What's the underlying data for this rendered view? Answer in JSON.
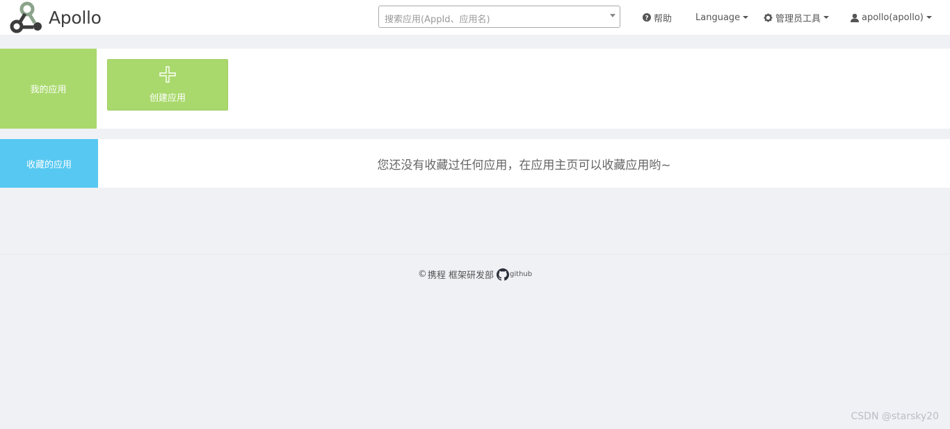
{
  "header": {
    "logo_text": "Apollo",
    "search": {
      "placeholder": "搜索应用(AppId、应用名)"
    },
    "nav": {
      "help": "帮助",
      "language": "Language",
      "admin_tools": "管理员工具",
      "user": "apollo(apollo)"
    }
  },
  "my_apps": {
    "section_label": "我的应用",
    "create_label": "创建应用"
  },
  "favorites": {
    "section_label": "收藏的应用",
    "empty_message": "您还没有收藏过任何应用，在应用主页可以收藏应用哟~"
  },
  "footer": {
    "copyright_symbol": "©",
    "company": "携程 框架研发部",
    "github_label": "github"
  },
  "watermark": "CSDN @starsky20",
  "colors": {
    "my_apps_green": "#a9d96c",
    "favorites_blue": "#57c8f2",
    "page_background": "#f0f1f5"
  }
}
